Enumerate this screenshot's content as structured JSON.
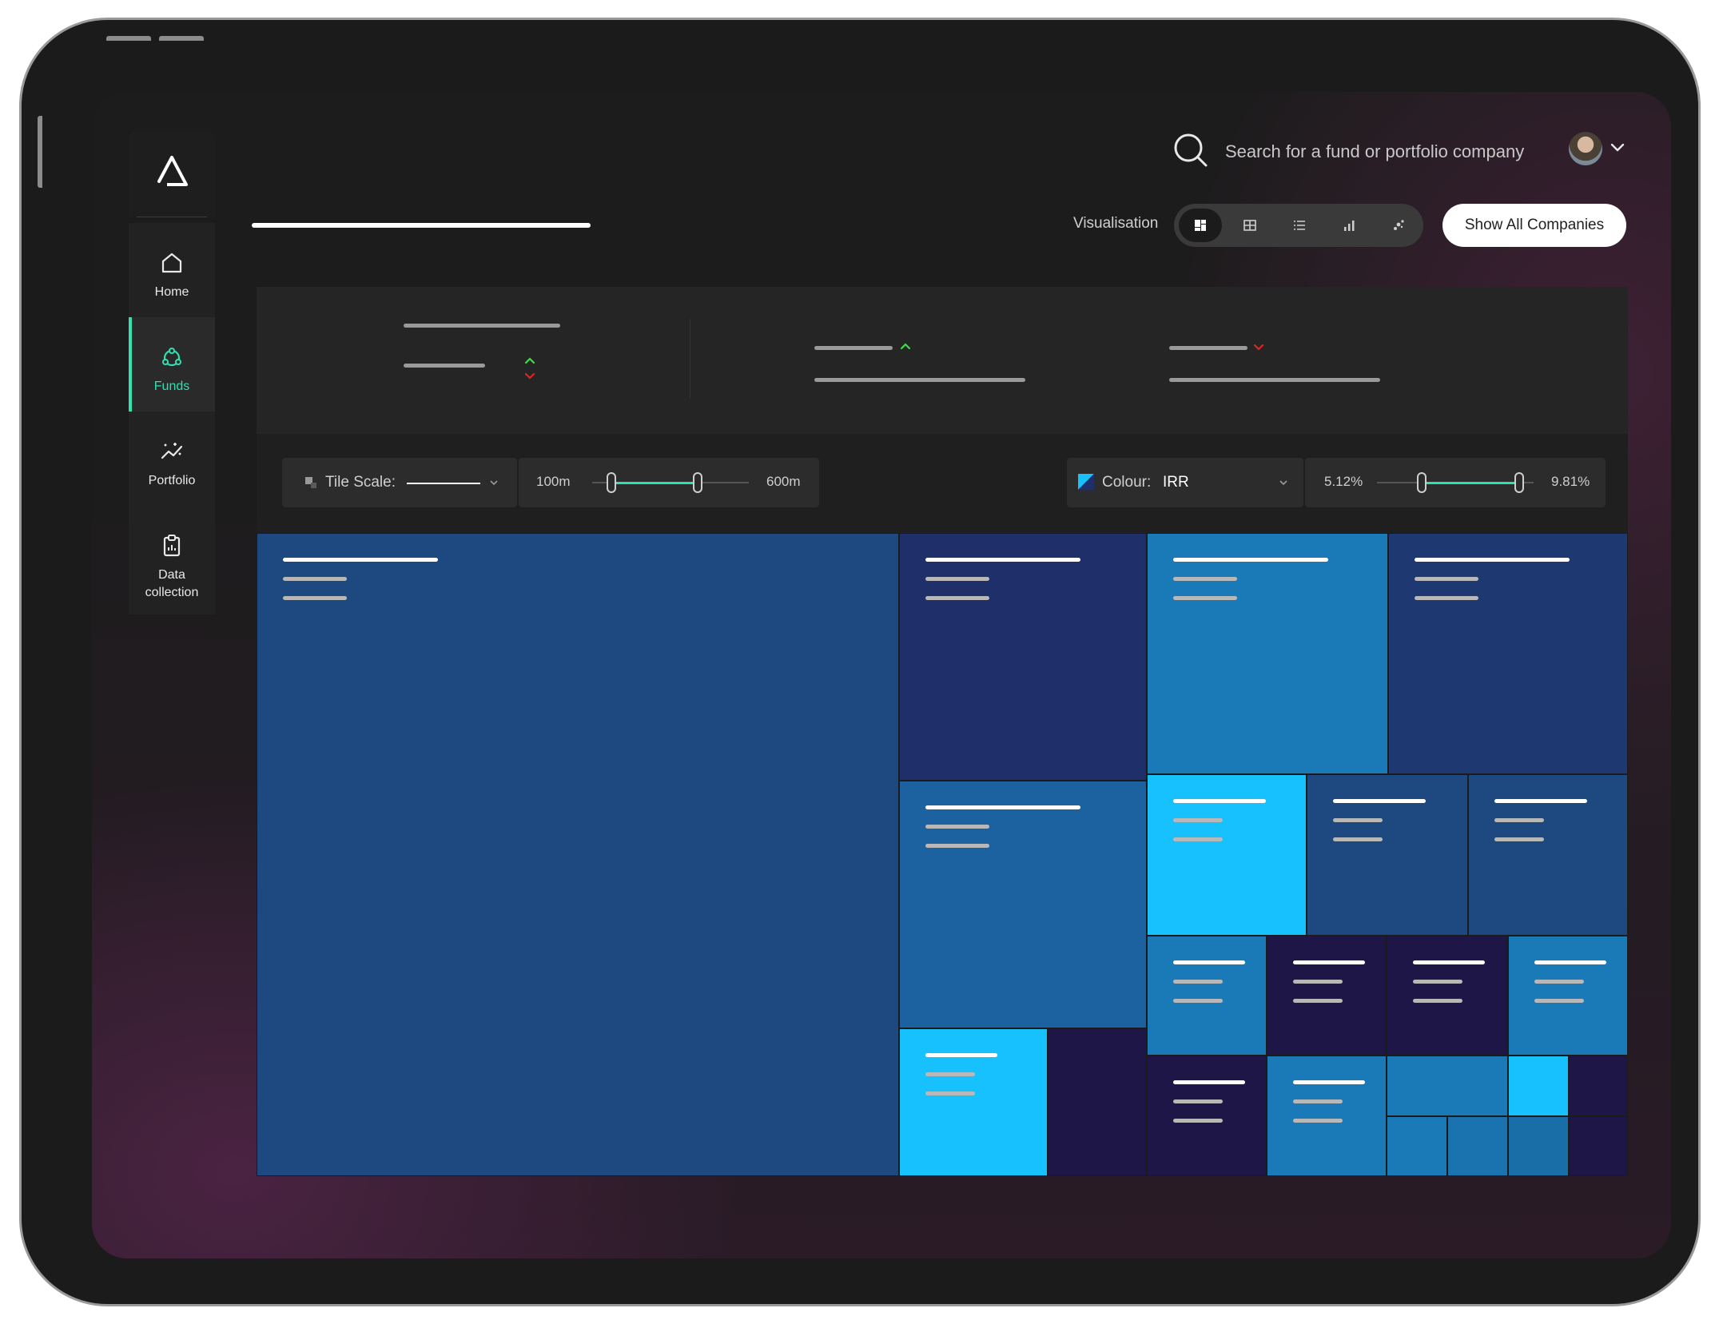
{
  "app": {
    "logo": "delta-logo-icon"
  },
  "sidebar": {
    "items": [
      {
        "label": "Home",
        "icon": "home-icon",
        "active": false
      },
      {
        "label": "Funds",
        "icon": "funds-icon",
        "active": true
      },
      {
        "label": "Portfolio",
        "icon": "portfolio-chart-icon",
        "active": false
      },
      {
        "label": "Data collection",
        "icon": "clipboard-icon",
        "active": false
      }
    ]
  },
  "header": {
    "search": {
      "placeholder": "Search for a fund or portfolio company",
      "icon": "search-icon"
    },
    "user": {
      "avatar": "avatar",
      "menu_icon": "chevron-down-icon"
    }
  },
  "toolbar": {
    "visualisation_label": "Visualisation",
    "visualisation_options": [
      "treemap-icon",
      "grid-icon",
      "list-icon",
      "bar-chart-icon",
      "scatter-icon"
    ],
    "visualisation_selected": "treemap-icon",
    "show_all_label": "Show All Companies"
  },
  "controls": {
    "tile_scale_label": "Tile Scale:",
    "tile_min": "100m",
    "tile_max": "600m",
    "colour_label": "Colour:",
    "colour_value": "IRR",
    "colour_min": "5.12%",
    "colour_max": "9.81%"
  },
  "colors": {
    "accent": "#2fe0b0",
    "up": "#3ddc4a",
    "down": "#e02424",
    "tile_light": "#17c1fd",
    "tile_mid": "#1a7ab8",
    "tile_blue": "#1d4880",
    "tile_navy": "#1e2f6a",
    "tile_deep": "#1f1648"
  }
}
